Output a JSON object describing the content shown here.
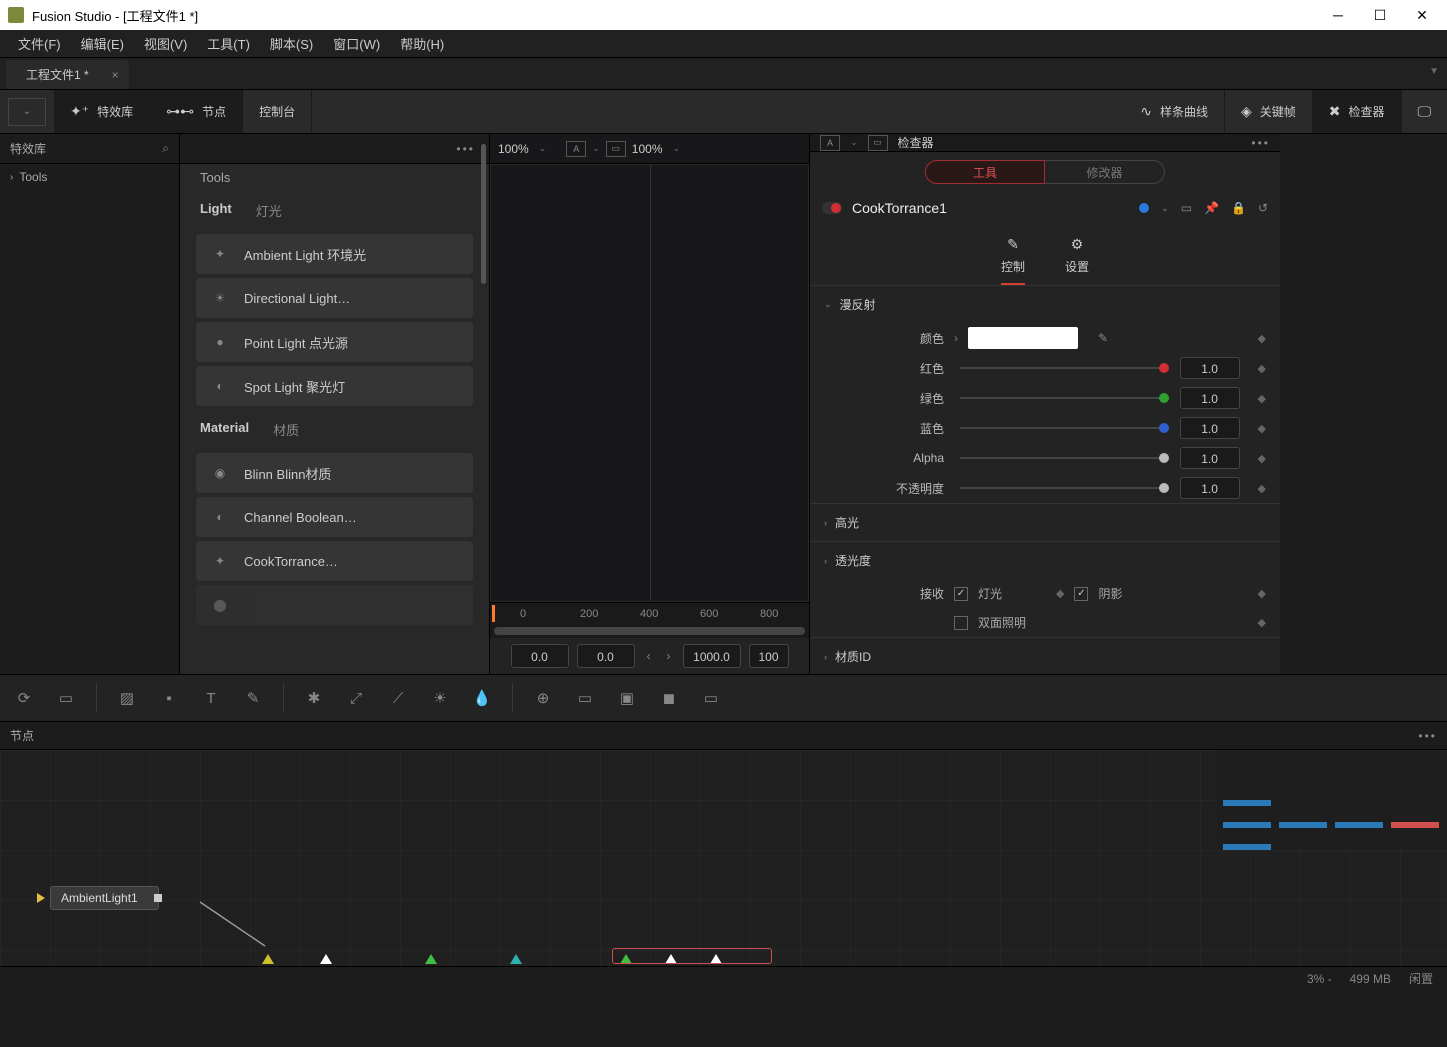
{
  "window": {
    "title": "Fusion Studio - [工程文件1 *]"
  },
  "menu": {
    "file": "文件(F)",
    "edit": "编辑(E)",
    "view": "视图(V)",
    "tool": "工具(T)",
    "script": "脚本(S)",
    "window": "窗口(W)",
    "help": "帮助(H)"
  },
  "tab": {
    "name": "工程文件1 *"
  },
  "toolbar": {
    "fxlib": "特效库",
    "nodes": "节点",
    "console": "控制台",
    "spline": "样条曲线",
    "keyframe": "关键帧",
    "inspector": "检查器"
  },
  "sidebar": {
    "title": "特效库",
    "tools": "Tools"
  },
  "efflib": {
    "head": "Tools",
    "cat_light_en": "Light",
    "cat_light_zh": "灯光",
    "light1": "Ambient Light 环境光",
    "light2": "Directional Light…",
    "light3": "Point Light 点光源",
    "light4": "Spot Light 聚光灯",
    "cat_mat_en": "Material",
    "cat_mat_zh": "材质",
    "mat1": "Blinn Blinn材质",
    "mat2": "Channel Boolean…",
    "mat3": "CookTorrance…"
  },
  "viewer": {
    "zoom1": "100%",
    "zoom2": "100%",
    "tick0": "0",
    "tick200": "200",
    "tick400": "400",
    "tick600": "600",
    "tick800": "800",
    "v1": "0.0",
    "v2": "0.0",
    "v3": "1000.0",
    "v4": "100"
  },
  "inspector": {
    "title": "检查器",
    "tab_tool": "工具",
    "tab_mod": "修改器",
    "node_name": "CookTorrance1",
    "sub_ctrl": "控制",
    "sub_set": "设置",
    "sec_diffuse": "漫反射",
    "lbl_color": "颜色",
    "lbl_red": "红色",
    "lbl_green": "绿色",
    "lbl_blue": "蓝色",
    "lbl_alpha": "Alpha",
    "lbl_opacity": "不透明度",
    "val_red": "1.0",
    "val_green": "1.0",
    "val_blue": "1.0",
    "val_alpha": "1.0",
    "val_opacity": "1.0",
    "sec_spec": "高光",
    "sec_trans": "透光度",
    "lbl_receive": "接收",
    "lbl_light": "灯光",
    "lbl_shadow": "阴影",
    "lbl_twoside": "双面照明",
    "sec_matid": "材质ID"
  },
  "nodepanel": {
    "title": "节点",
    "node1": "AmbientLight1"
  },
  "status": {
    "pct": "3% -",
    "mem": "499 MB",
    "idle": "闲置"
  }
}
